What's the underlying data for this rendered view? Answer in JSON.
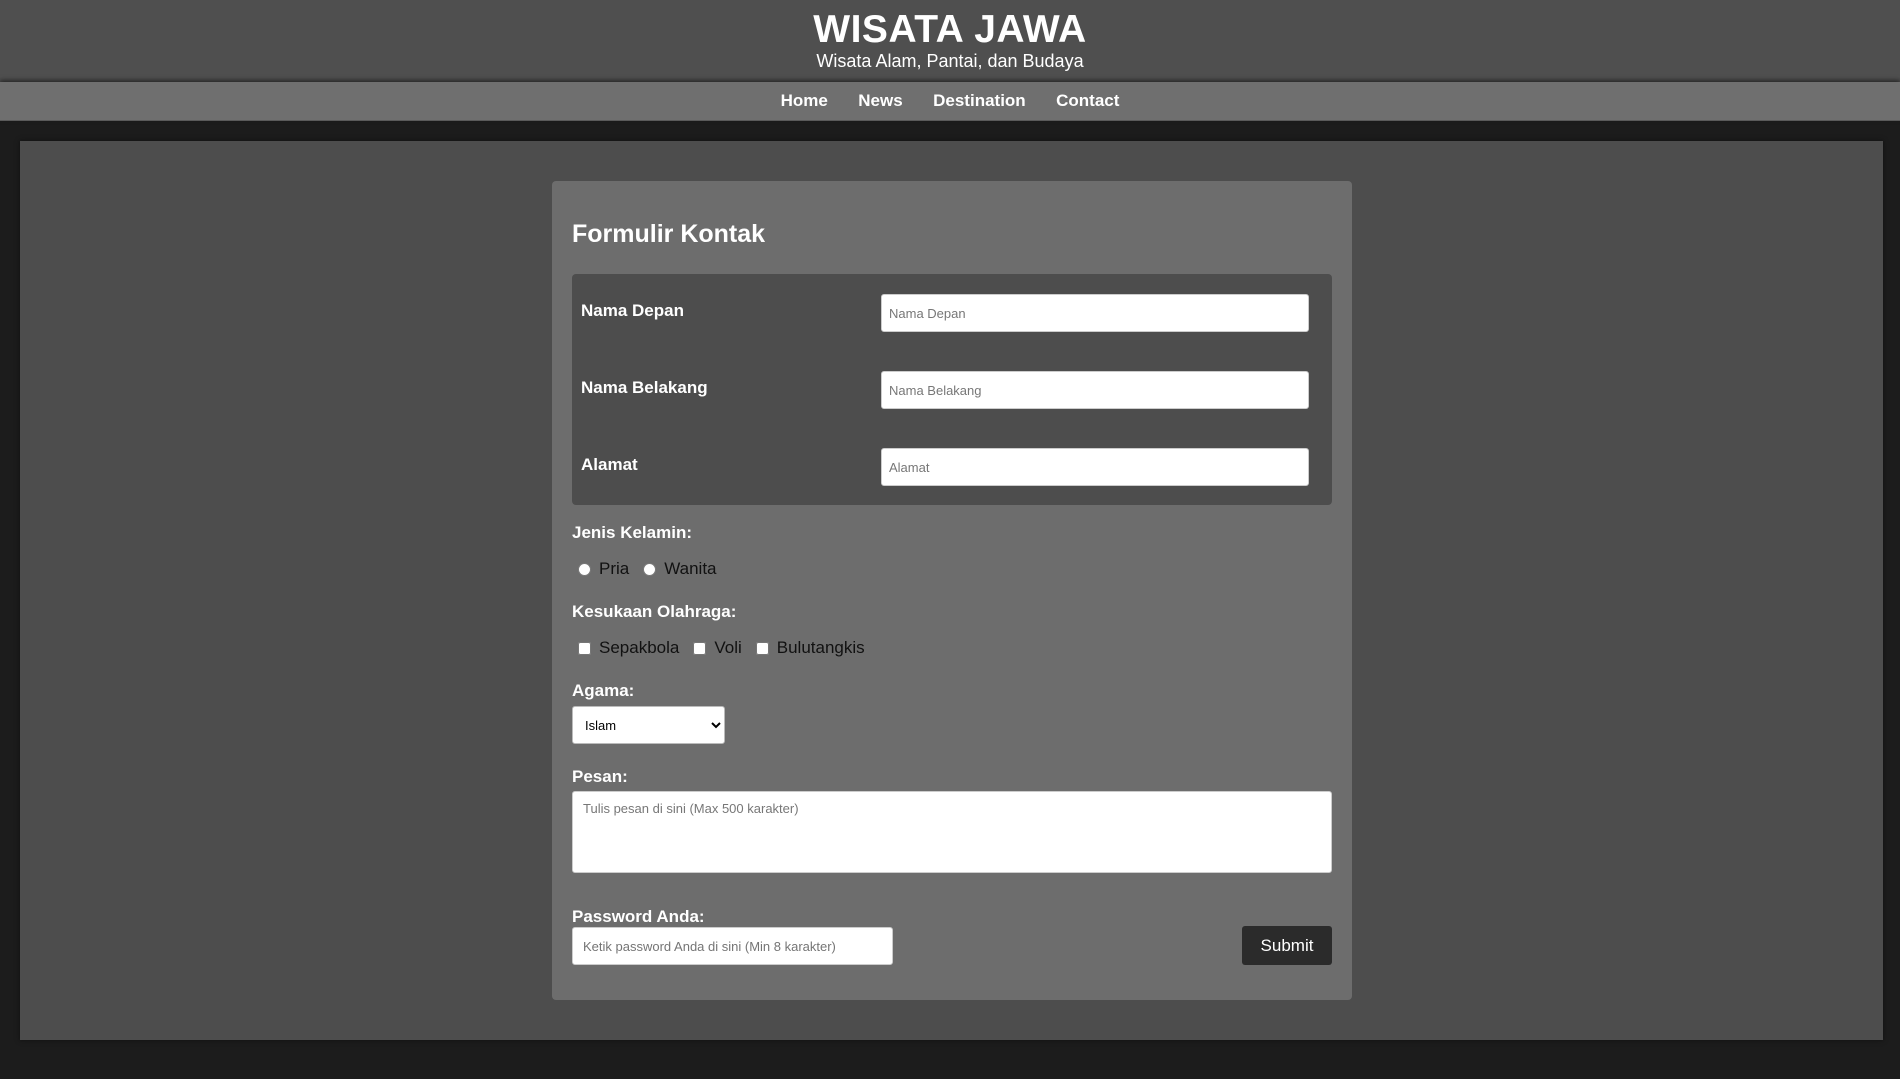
{
  "header": {
    "title": "WISATA JAWA",
    "subtitle": "Wisata Alam, Pantai, dan Budaya"
  },
  "nav": {
    "items": [
      "Home",
      "News",
      "Destination",
      "Contact"
    ]
  },
  "form": {
    "title": "Formulir Kontak",
    "first_name": {
      "label": "Nama Depan",
      "placeholder": "Nama Depan",
      "value": ""
    },
    "last_name": {
      "label": "Nama Belakang",
      "placeholder": "Nama Belakang",
      "value": ""
    },
    "address": {
      "label": "Alamat",
      "placeholder": "Alamat",
      "value": ""
    },
    "gender": {
      "label": "Jenis Kelamin:",
      "options": [
        "Pria",
        "Wanita"
      ],
      "selected": null
    },
    "sports": {
      "label": "Kesukaan Olahraga:",
      "options": [
        "Sepakbola",
        "Voli",
        "Bulutangkis"
      ],
      "checked": []
    },
    "religion": {
      "label": "Agama:",
      "selected": "Islam"
    },
    "message": {
      "label": "Pesan:",
      "placeholder": "Tulis pesan di sini (Max 500 karakter)",
      "value": ""
    },
    "password": {
      "label": "Password Anda:",
      "placeholder": "Ketik password Anda di sini (Min 8 karakter)",
      "value": ""
    },
    "submit_label": "Submit"
  },
  "colors": {
    "page_background": "#1c1c1c",
    "header_background": "#4f4f4f",
    "nav_background": "#6f6f6f",
    "panel_background": "#4d4d4d",
    "card_background": "#6d6d6d",
    "submit_background": "#2b2b2b"
  }
}
